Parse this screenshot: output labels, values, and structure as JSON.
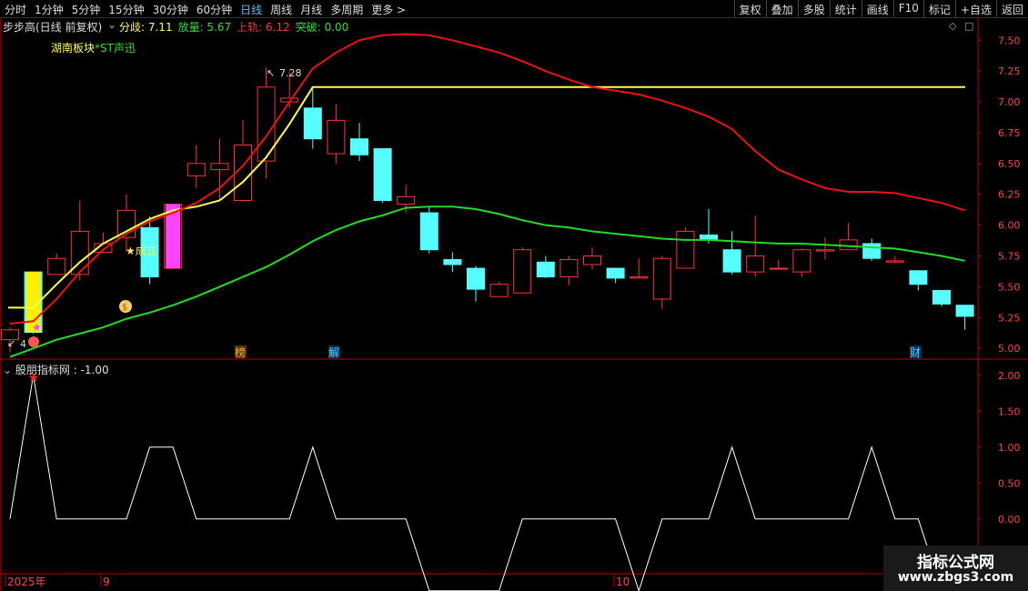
{
  "toolbar": {
    "periods": [
      "分时",
      "1分钟",
      "5分钟",
      "15分钟",
      "30分钟",
      "60分钟",
      "日线",
      "周线",
      "月线",
      "多周期",
      "更多 >"
    ],
    "active_period": "日线",
    "tools": [
      "复权",
      "叠加",
      "多股",
      "统计",
      "画线",
      "F10",
      "标记",
      "+自选",
      "返回"
    ]
  },
  "main_panel": {
    "title": "步步高(日线 前复权)",
    "indicators": [
      {
        "label": "分歧: 7.11",
        "color": "#ffff55"
      },
      {
        "label": "放量: 5.67",
        "color": "#33dd33"
      },
      {
        "label": "上轨: 6.12",
        "color": "#ff3333"
      },
      {
        "label": "突破: 0.00",
        "color": "#33dd33"
      }
    ],
    "sector_label": "湖南板块",
    "sector_stock": "*ST声迅",
    "high_label": "7.28",
    "low_label": "4",
    "signal_label": "★成立",
    "markers": [
      "榜",
      "解",
      "财"
    ],
    "y_ticks": [
      "7.50",
      "7.25",
      "7.00",
      "6.75",
      "6.50",
      "6.25",
      "6.00",
      "5.75",
      "5.50",
      "5.25",
      "5.00"
    ]
  },
  "sub_panel": {
    "title": "股朋指标网 : -1.00",
    "y_ticks": [
      "2.00",
      "1.50",
      "1.00",
      "0.50",
      "0.00",
      "-0.50"
    ]
  },
  "x_axis": {
    "labels": [
      "2025年",
      "9",
      "10"
    ]
  },
  "watermark": {
    "line1": "指标公式网",
    "line2": "www.zbgs3.com"
  },
  "colors": {
    "up": "#ff3333",
    "down": "#55ffff",
    "yellow": "#ffff44",
    "green": "#22dd22",
    "red_line": "#ee1111",
    "axis": "#bb0000",
    "signal_bar_yellow": "#ffee00",
    "signal_bar_magenta": "#ff44ff"
  },
  "chart_data": {
    "type": "candlestick",
    "candles": [
      [
        5.07,
        5.15,
        5.17,
        4.97
      ],
      [
        5.62,
        5.13,
        5.62,
        5.12
      ],
      [
        5.6,
        5.73,
        5.77,
        5.6
      ],
      [
        5.6,
        5.95,
        6.2,
        5.55
      ],
      [
        5.78,
        5.85,
        5.94,
        5.78
      ],
      [
        5.9,
        6.12,
        6.25,
        5.78
      ],
      [
        5.98,
        5.58,
        6.07,
        5.52
      ],
      [
        5.65,
        6.17,
        6.17,
        5.64
      ],
      [
        6.4,
        6.5,
        6.65,
        6.3
      ],
      [
        6.45,
        6.5,
        6.7,
        6.2
      ],
      [
        6.2,
        6.65,
        6.85,
        6.2
      ],
      [
        6.52,
        7.12,
        7.28,
        6.38
      ],
      [
        7.0,
        7.03,
        7.25,
        6.95
      ],
      [
        6.95,
        6.7,
        7.12,
        6.62
      ],
      [
        6.58,
        6.85,
        6.98,
        6.5
      ],
      [
        6.7,
        6.57,
        6.83,
        6.52
      ],
      [
        6.62,
        6.2,
        6.62,
        6.18
      ],
      [
        6.17,
        6.23,
        6.33,
        6.1
      ],
      [
        6.1,
        5.8,
        6.15,
        5.77
      ],
      [
        5.72,
        5.68,
        5.78,
        5.62
      ],
      [
        5.65,
        5.48,
        5.67,
        5.38
      ],
      [
        5.42,
        5.52,
        5.54,
        5.42
      ],
      [
        5.45,
        5.8,
        5.82,
        5.45
      ],
      [
        5.7,
        5.58,
        5.75,
        5.57
      ],
      [
        5.58,
        5.72,
        5.75,
        5.51
      ],
      [
        5.68,
        5.75,
        5.82,
        5.64
      ],
      [
        5.65,
        5.57,
        5.65,
        5.53
      ],
      [
        5.57,
        5.58,
        5.73,
        5.57
      ],
      [
        5.4,
        5.73,
        5.75,
        5.32
      ],
      [
        5.65,
        5.95,
        5.98,
        5.65
      ],
      [
        5.92,
        5.88,
        6.13,
        5.85
      ],
      [
        5.8,
        5.62,
        5.95,
        5.6
      ],
      [
        5.62,
        5.75,
        6.08,
        5.58
      ],
      [
        5.65,
        5.65,
        5.72,
        5.65
      ],
      [
        5.62,
        5.8,
        5.81,
        5.58
      ],
      [
        5.79,
        5.8,
        5.9,
        5.72
      ],
      [
        5.8,
        5.88,
        6.02,
        5.8
      ],
      [
        5.85,
        5.73,
        5.89,
        5.71
      ],
      [
        5.7,
        5.71,
        5.75,
        5.69
      ],
      [
        5.63,
        5.52,
        5.63,
        5.47
      ],
      [
        5.47,
        5.36,
        5.47,
        5.34
      ],
      [
        5.35,
        5.26,
        5.35,
        5.15
      ]
    ],
    "signal_bars": [
      {
        "index": 1,
        "color": "#ffee00"
      },
      {
        "index": 6,
        "color": "#55ffff"
      },
      {
        "index": 7,
        "color": "#ff44ff"
      }
    ],
    "lines": [
      {
        "name": "分歧",
        "color": "#ffff44",
        "values": [
          null,
          5.33,
          5.52,
          5.7,
          5.85,
          5.95,
          6.05,
          6.12,
          6.15,
          6.2,
          6.35,
          6.55,
          6.82,
          7.12,
          7.12,
          7.12,
          7.12,
          7.12,
          7.12,
          7.12,
          7.12,
          7.12,
          7.12,
          7.12,
          7.12,
          7.12,
          7.12,
          7.12,
          7.12,
          7.12,
          7.12,
          7.12,
          7.12,
          7.12,
          7.12,
          7.12,
          7.12,
          7.12,
          7.12,
          7.12,
          7.12,
          7.12
        ]
      },
      {
        "name": "上轨",
        "color": "#ee1111",
        "values": [
          5.2,
          5.22,
          5.4,
          5.62,
          5.8,
          5.93,
          6.03,
          6.1,
          6.18,
          6.3,
          6.48,
          6.72,
          7.0,
          7.27,
          7.4,
          7.5,
          7.54,
          7.55,
          7.54,
          7.5,
          7.45,
          7.4,
          7.33,
          7.25,
          7.18,
          7.12,
          7.09,
          7.06,
          7.01,
          6.95,
          6.88,
          6.78,
          6.6,
          6.45,
          6.37,
          6.3,
          6.27,
          6.27,
          6.26,
          6.22,
          6.18,
          6.12
        ]
      },
      {
        "name": "放量",
        "color": "#22dd22",
        "values": [
          4.93,
          5.0,
          5.07,
          5.12,
          5.17,
          5.24,
          5.29,
          5.35,
          5.42,
          5.5,
          5.58,
          5.66,
          5.76,
          5.87,
          5.96,
          6.03,
          6.08,
          6.14,
          6.15,
          6.15,
          6.13,
          6.09,
          6.04,
          6.0,
          5.98,
          5.95,
          5.93,
          5.91,
          5.89,
          5.88,
          5.88,
          5.87,
          5.86,
          5.85,
          5.85,
          5.84,
          5.83,
          5.82,
          5.81,
          5.78,
          5.75,
          5.71
        ]
      }
    ],
    "sub_series": {
      "name": "股朋指标",
      "values": [
        0,
        2,
        0,
        0,
        0,
        0,
        1,
        1,
        0,
        0,
        0,
        0,
        0,
        1,
        0,
        0,
        0,
        0,
        -1,
        -1,
        -1,
        -1,
        0,
        0,
        0,
        0,
        0,
        -1,
        0,
        0,
        0,
        1,
        0,
        0,
        0,
        0,
        0,
        1,
        0,
        0,
        -1,
        -1
      ]
    },
    "main_ylim": [
      4.92,
      7.62
    ],
    "sub_ylim": [
      -0.75,
      2.2
    ]
  }
}
